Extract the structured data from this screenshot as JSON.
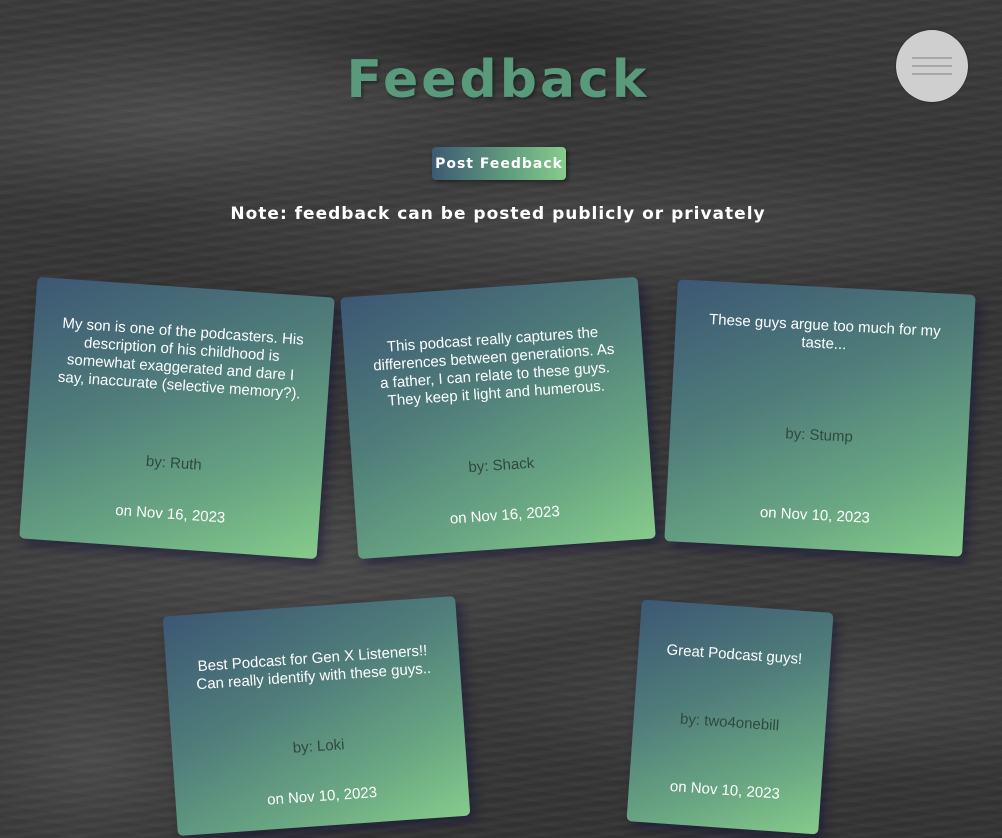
{
  "header": {
    "title": "Feedback",
    "menu_icon": "hamburger-menu-icon"
  },
  "actions": {
    "post_feedback_label": "Post Feedback"
  },
  "note": "Note: feedback can be posted publicly or privately",
  "colors": {
    "title": "#5a9a7c",
    "card_gradient_start": "#3c5774",
    "card_gradient_end": "#86cb8b",
    "author_text": "#2e4a40"
  },
  "feedback": [
    {
      "message": "My son is one of the podcasters. His description of his childhood is somewhat exaggerated and dare I say, inaccurate (selective memory?).",
      "author": "by: Ruth",
      "date": "on Nov 16, 2023"
    },
    {
      "message": "This podcast really captures the differences between generations. As a father, I can relate to these guys. They keep it light and humerous.",
      "author": "by: Shack",
      "date": "on Nov 16, 2023"
    },
    {
      "message": "These guys argue too much for my taste...",
      "author": "by: Stump",
      "date": "on Nov 10, 2023"
    },
    {
      "message": "Best Podcast for Gen X Listeners!! Can really identify with these guys..",
      "author": "by: Loki",
      "date": "on Nov 10, 2023"
    },
    {
      "message": "Great Podcast guys!",
      "author": "by: two4onebill",
      "date": "on Nov 10, 2023"
    }
  ]
}
